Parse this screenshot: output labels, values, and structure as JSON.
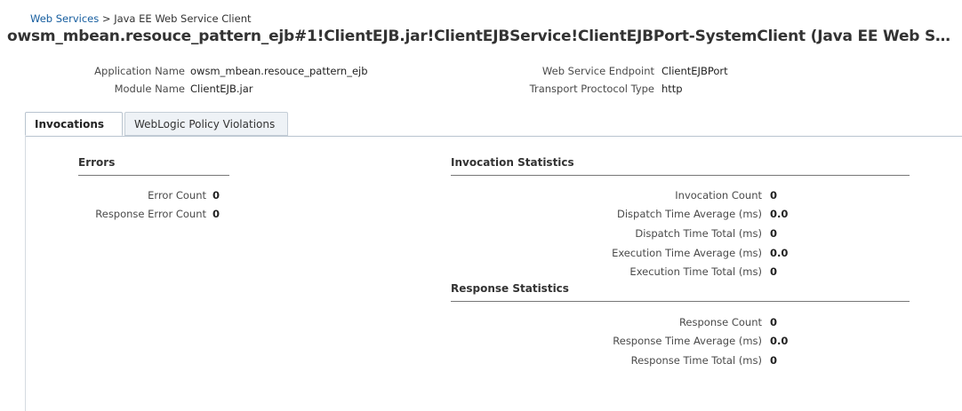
{
  "breadcrumb": {
    "link": "Web Services",
    "separator": ">",
    "current": "Java EE Web Service Client"
  },
  "page_title": "owsm_mbean.resouce_pattern_ejb#1!ClientEJB.jar!ClientEJBService!ClientEJBPort-SystemClient (Java EE Web Ser...",
  "info": {
    "application_name": {
      "label": "Application Name",
      "value": "owsm_mbean.resouce_pattern_ejb"
    },
    "module_name": {
      "label": "Module Name",
      "value": "ClientEJB.jar"
    },
    "endpoint": {
      "label": "Web Service Endpoint",
      "value": "ClientEJBPort"
    },
    "transport": {
      "label": "Transport Proctocol Type",
      "value": "http"
    }
  },
  "tabs": [
    {
      "label": "Invocations",
      "active": true
    },
    {
      "label": "WebLogic Policy Violations",
      "active": false
    }
  ],
  "errors": {
    "title": "Errors",
    "rows": [
      {
        "label": "Error Count",
        "value": "0"
      },
      {
        "label": "Response Error Count",
        "value": "0"
      }
    ]
  },
  "invocation_stats": {
    "title": "Invocation Statistics",
    "rows": [
      {
        "label": "Invocation Count",
        "value": "0"
      },
      {
        "label": "Dispatch Time Average (ms)",
        "value": "0.0"
      },
      {
        "label": "Dispatch Time Total (ms)",
        "value": "0"
      },
      {
        "label": "Execution Time Average (ms)",
        "value": "0.0"
      },
      {
        "label": "Execution Time Total (ms)",
        "value": "0"
      }
    ]
  },
  "response_stats": {
    "title": "Response Statistics",
    "rows": [
      {
        "label": "Response Count",
        "value": "0"
      },
      {
        "label": "Response Time Average (ms)",
        "value": "0.0"
      },
      {
        "label": "Response Time Total (ms)",
        "value": "0"
      }
    ]
  }
}
